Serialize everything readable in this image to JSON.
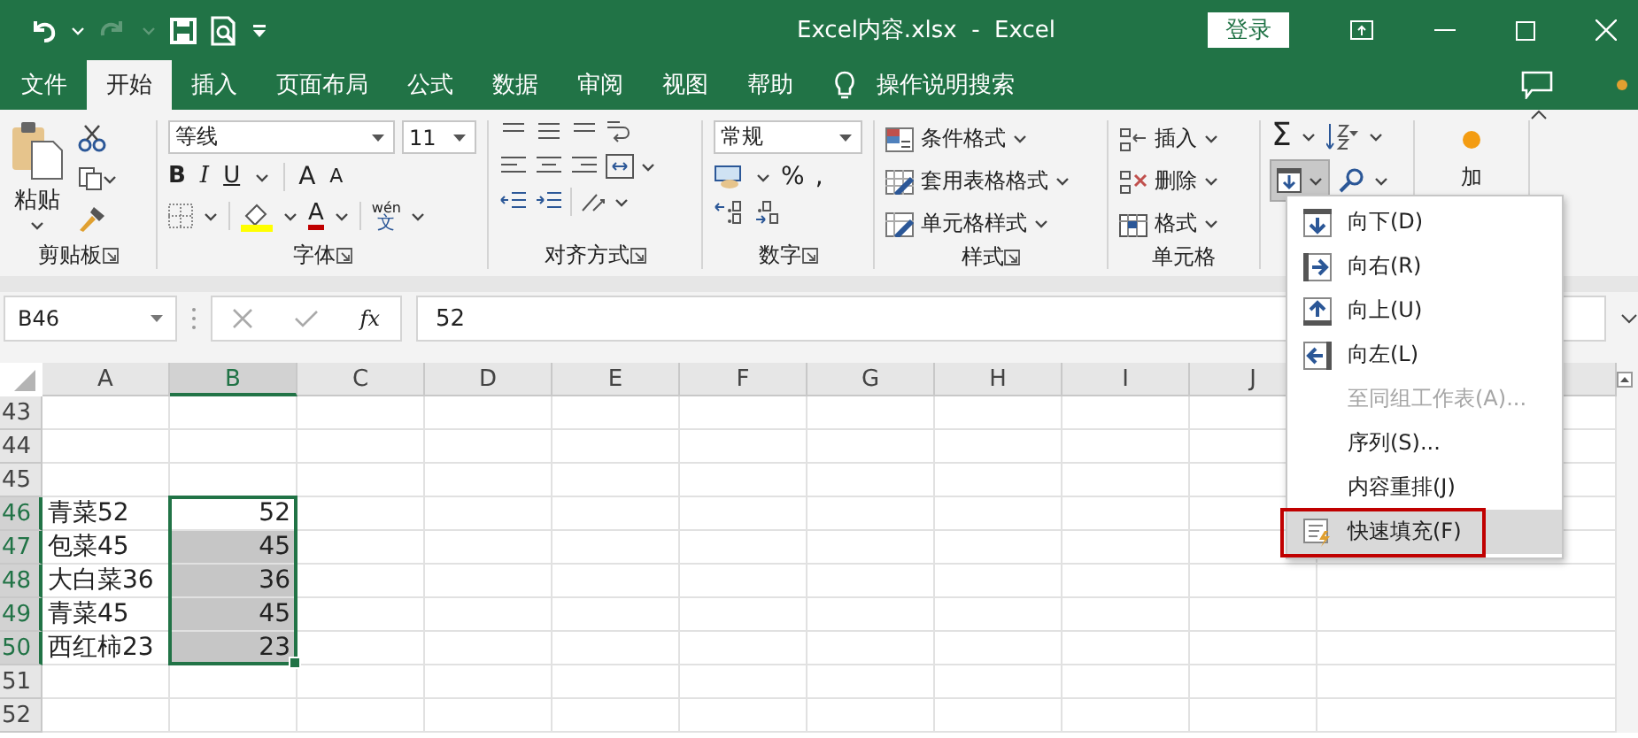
{
  "title_bar": {
    "title": "Excel内容.xlsx  -  Excel",
    "login_button": "登录",
    "redo_disabled": true
  },
  "ribbon_tabs": [
    {
      "label": "文件",
      "selected": false
    },
    {
      "label": "开始",
      "selected": true
    },
    {
      "label": "插入",
      "selected": false
    },
    {
      "label": "页面布局",
      "selected": false
    },
    {
      "label": "公式",
      "selected": false
    },
    {
      "label": "数据",
      "selected": false
    },
    {
      "label": "审阅",
      "selected": false
    },
    {
      "label": "视图",
      "selected": false
    },
    {
      "label": "帮助",
      "selected": false
    }
  ],
  "tell_me": "操作说明搜索",
  "ribbon": {
    "clipboard": {
      "paste": "粘贴",
      "label": "剪贴板"
    },
    "font": {
      "font_name": "等线",
      "font_size": "11",
      "bold": "B",
      "italic": "I",
      "underline": "U",
      "grow": "A",
      "shrink": "A",
      "font_color": "A",
      "phonetic": "wén",
      "phonetic_char": "文",
      "label": "字体"
    },
    "alignment": {
      "label": "对齐方式"
    },
    "number": {
      "format": "常规",
      "percent": "%",
      "comma": ",",
      "label": "数字"
    },
    "styles": {
      "items": [
        "条件格式",
        "套用表格格式",
        "单元格样式"
      ],
      "label": "样式"
    },
    "cells": {
      "items": [
        "插入",
        "删除",
        "格式"
      ],
      "label": "单元格"
    },
    "editing": {
      "sum": "Σ",
      "fill_expanded": true
    },
    "addins": {
      "label": "加"
    }
  },
  "formula_bar": {
    "name_box": "B46",
    "function_label": "fx",
    "value": "52"
  },
  "sheet": {
    "columns": [
      {
        "label": "A",
        "selected": false
      },
      {
        "label": "B",
        "selected": true
      },
      {
        "label": "C",
        "selected": false
      },
      {
        "label": "D",
        "selected": false
      },
      {
        "label": "E",
        "selected": false
      },
      {
        "label": "F",
        "selected": false
      },
      {
        "label": "G",
        "selected": false
      },
      {
        "label": "H",
        "selected": false
      },
      {
        "label": "I",
        "selected": false
      },
      {
        "label": "J",
        "selected": false
      }
    ],
    "rows": [
      {
        "number": "43",
        "selected": false,
        "cells": [
          "",
          ""
        ]
      },
      {
        "number": "44",
        "selected": false,
        "cells": [
          "",
          ""
        ]
      },
      {
        "number": "45",
        "selected": false,
        "cells": [
          "",
          ""
        ]
      },
      {
        "number": "46",
        "selected": true,
        "cells": [
          "青菜52",
          "52"
        ]
      },
      {
        "number": "47",
        "selected": true,
        "cells": [
          "包菜45",
          "45"
        ]
      },
      {
        "number": "48",
        "selected": true,
        "cells": [
          "大白菜36",
          "36"
        ]
      },
      {
        "number": "49",
        "selected": true,
        "cells": [
          "青菜45",
          "45"
        ]
      },
      {
        "number": "50",
        "selected": true,
        "cells": [
          "西红柿23",
          "23"
        ]
      },
      {
        "number": "51",
        "selected": false,
        "cells": [
          "",
          ""
        ]
      },
      {
        "number": "52",
        "selected": false,
        "cells": [
          "",
          ""
        ]
      }
    ]
  },
  "fill_menu": [
    {
      "kind": "down",
      "label": "向下(D)",
      "disabled": false,
      "selected": false
    },
    {
      "kind": "right",
      "label": "向右(R)",
      "disabled": false,
      "selected": false
    },
    {
      "kind": "up",
      "label": "向上(U)",
      "disabled": false,
      "selected": false
    },
    {
      "kind": "left",
      "label": "向左(L)",
      "disabled": false,
      "selected": false
    },
    {
      "kind": "plain",
      "label": "至同组工作表(A)...",
      "disabled": true,
      "selected": false
    },
    {
      "kind": "plain",
      "label": "序列(S)...",
      "disabled": false,
      "selected": false
    },
    {
      "kind": "plain",
      "label": "内容重排(J)",
      "disabled": false,
      "selected": false
    },
    {
      "kind": "flash",
      "label": "快速填充(F)",
      "disabled": false,
      "selected": true
    }
  ]
}
